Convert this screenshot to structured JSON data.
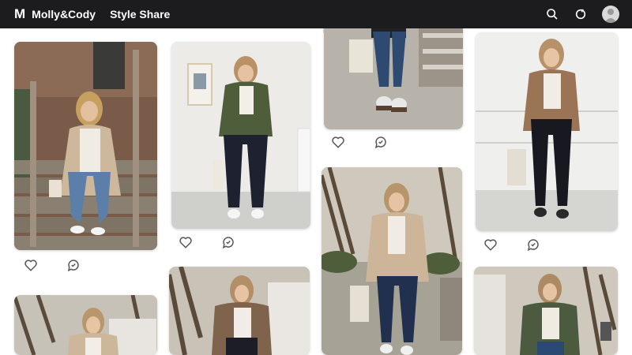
{
  "header": {
    "logo_letter": "M",
    "brand": "Molly&Cody",
    "nav_label": "Style Share",
    "icons": [
      "search-icon",
      "refresh-icon",
      "user-avatar"
    ]
  },
  "colors": {
    "topbar": "#1c1c1e",
    "background": "#ffffff",
    "icon_stroke": "#555555"
  },
  "feed": {
    "posts": [
      {
        "id": "p1",
        "scene": "outdoor stairs, teddy jacket, blue jeans",
        "actions": [
          "heart-icon",
          "comment-icon"
        ]
      },
      {
        "id": "p2",
        "scene": "white wall, olive jacket, black jeans",
        "actions": [
          "heart-icon",
          "comment-icon"
        ]
      },
      {
        "id": "p3",
        "scene": "legs and sneakers on deck",
        "actions": [
          "heart-icon",
          "comment-icon"
        ]
      },
      {
        "id": "p4",
        "scene": "brown cardigan by white wall",
        "actions": [
          "heart-icon",
          "comment-icon"
        ]
      },
      {
        "id": "p5",
        "scene": "teddy jacket in garden",
        "actions": []
      },
      {
        "id": "p6",
        "scene": "teddy jacket by house",
        "actions": []
      },
      {
        "id": "p7",
        "scene": "brown coat by trees",
        "actions": []
      },
      {
        "id": "p8",
        "scene": "green coat by house",
        "actions": []
      }
    ]
  }
}
